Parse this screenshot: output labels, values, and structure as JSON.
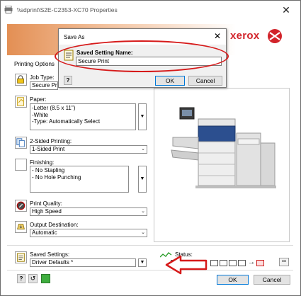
{
  "window": {
    "title": "\\\\sdprint\\S2E-C2353-XC70 Properties",
    "close_glyph": "✕"
  },
  "banner": {
    "brand": "xerox",
    "brand_color": "#d2232a"
  },
  "left_panel": {
    "section_title": "Printing Options",
    "job_type": {
      "label": "Job Type:",
      "value": "Secure Prin"
    },
    "paper": {
      "label": "Paper:",
      "lines": [
        "-Letter (8.5 x 11\")",
        "-White",
        "-Type: Automatically Select"
      ]
    },
    "two_sided": {
      "label": "2-Sided Printing:",
      "value": "1-Sided Print"
    },
    "finishing": {
      "label": "Finishing:",
      "lines": [
        "- No Stapling",
        "- No Hole Punching"
      ]
    },
    "print_quality": {
      "label": "Print Quality:",
      "value": "High Speed"
    },
    "output_destination": {
      "label": "Output Destination:",
      "value": "Automatic"
    }
  },
  "saved_settings": {
    "label": "Saved Settings:",
    "value": "Driver Defaults *",
    "status_label": "Status:",
    "more_glyph": "•••"
  },
  "footer": {
    "help_glyph": "?",
    "ok_label": "OK",
    "cancel_label": "Cancel"
  },
  "save_dialog": {
    "title": "Save As",
    "close_glyph": "✕",
    "field_label": "Saved Setting Name:",
    "field_value": "Secure Print",
    "help_glyph": "?",
    "ok_label": "OK",
    "cancel_label": "Cancel"
  },
  "annotation_color": "#d61a1a"
}
